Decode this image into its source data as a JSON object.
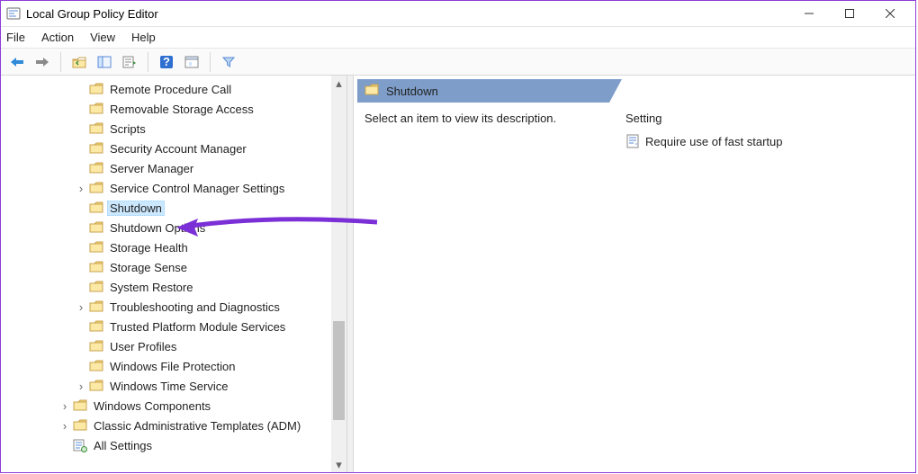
{
  "window": {
    "title": "Local Group Policy Editor"
  },
  "menu": [
    "File",
    "Action",
    "View",
    "Help"
  ],
  "tree": {
    "items": [
      {
        "indent": 3,
        "expander": "",
        "icon": "folder",
        "label": "Remote Procedure Call",
        "selected": false
      },
      {
        "indent": 3,
        "expander": "",
        "icon": "folder",
        "label": "Removable Storage Access",
        "selected": false
      },
      {
        "indent": 3,
        "expander": "",
        "icon": "folder",
        "label": "Scripts",
        "selected": false
      },
      {
        "indent": 3,
        "expander": "",
        "icon": "folder",
        "label": "Security Account Manager",
        "selected": false
      },
      {
        "indent": 3,
        "expander": "",
        "icon": "folder",
        "label": "Server Manager",
        "selected": false
      },
      {
        "indent": 3,
        "expander": ">",
        "icon": "folder",
        "label": "Service Control Manager Settings",
        "selected": false
      },
      {
        "indent": 3,
        "expander": "",
        "icon": "folder",
        "label": "Shutdown",
        "selected": true
      },
      {
        "indent": 3,
        "expander": "",
        "icon": "folder",
        "label": "Shutdown Options",
        "selected": false
      },
      {
        "indent": 3,
        "expander": "",
        "icon": "folder",
        "label": "Storage Health",
        "selected": false
      },
      {
        "indent": 3,
        "expander": "",
        "icon": "folder",
        "label": "Storage Sense",
        "selected": false
      },
      {
        "indent": 3,
        "expander": "",
        "icon": "folder",
        "label": "System Restore",
        "selected": false
      },
      {
        "indent": 3,
        "expander": ">",
        "icon": "folder",
        "label": "Troubleshooting and Diagnostics",
        "selected": false
      },
      {
        "indent": 3,
        "expander": "",
        "icon": "folder",
        "label": "Trusted Platform Module Services",
        "selected": false
      },
      {
        "indent": 3,
        "expander": "",
        "icon": "folder",
        "label": "User Profiles",
        "selected": false
      },
      {
        "indent": 3,
        "expander": "",
        "icon": "folder",
        "label": "Windows File Protection",
        "selected": false
      },
      {
        "indent": 3,
        "expander": ">",
        "icon": "folder",
        "label": "Windows Time Service",
        "selected": false
      },
      {
        "indent": 2,
        "expander": ">",
        "icon": "folder",
        "label": "Windows Components",
        "selected": false
      },
      {
        "indent": 2,
        "expander": ">",
        "icon": "folder",
        "label": "Classic Administrative Templates (ADM)",
        "selected": false
      },
      {
        "indent": 2,
        "expander": "",
        "icon": "allsettings",
        "label": "All Settings",
        "selected": false
      }
    ],
    "scroll": {
      "thumb_top_pct": 63,
      "thumb_height_pct": 27
    }
  },
  "right": {
    "heading": "Shutdown",
    "description": "Select an item to view its description.",
    "columns": {
      "setting": "Setting"
    },
    "settings": [
      {
        "label": "Require use of fast startup"
      }
    ]
  }
}
